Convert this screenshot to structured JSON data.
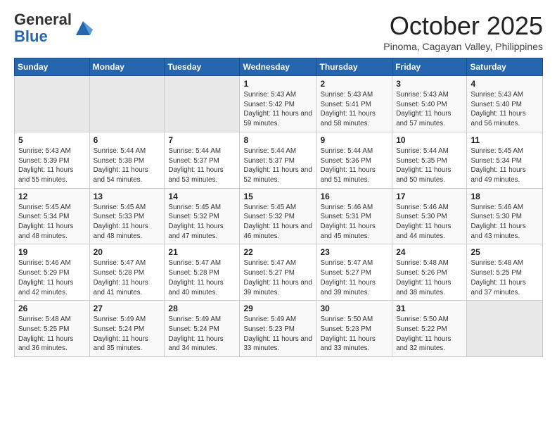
{
  "header": {
    "logo_line1": "General",
    "logo_line2": "Blue",
    "month_title": "October 2025",
    "location": "Pinoma, Cagayan Valley, Philippines"
  },
  "days_of_week": [
    "Sunday",
    "Monday",
    "Tuesday",
    "Wednesday",
    "Thursday",
    "Friday",
    "Saturday"
  ],
  "weeks": [
    [
      {
        "day": "",
        "sunrise": "",
        "sunset": "",
        "daylight": "",
        "empty": true
      },
      {
        "day": "",
        "sunrise": "",
        "sunset": "",
        "daylight": "",
        "empty": true
      },
      {
        "day": "",
        "sunrise": "",
        "sunset": "",
        "daylight": "",
        "empty": true
      },
      {
        "day": "1",
        "sunrise": "Sunrise: 5:43 AM",
        "sunset": "Sunset: 5:42 PM",
        "daylight": "Daylight: 11 hours and 59 minutes."
      },
      {
        "day": "2",
        "sunrise": "Sunrise: 5:43 AM",
        "sunset": "Sunset: 5:41 PM",
        "daylight": "Daylight: 11 hours and 58 minutes."
      },
      {
        "day": "3",
        "sunrise": "Sunrise: 5:43 AM",
        "sunset": "Sunset: 5:40 PM",
        "daylight": "Daylight: 11 hours and 57 minutes."
      },
      {
        "day": "4",
        "sunrise": "Sunrise: 5:43 AM",
        "sunset": "Sunset: 5:40 PM",
        "daylight": "Daylight: 11 hours and 56 minutes."
      }
    ],
    [
      {
        "day": "5",
        "sunrise": "Sunrise: 5:43 AM",
        "sunset": "Sunset: 5:39 PM",
        "daylight": "Daylight: 11 hours and 55 minutes."
      },
      {
        "day": "6",
        "sunrise": "Sunrise: 5:44 AM",
        "sunset": "Sunset: 5:38 PM",
        "daylight": "Daylight: 11 hours and 54 minutes."
      },
      {
        "day": "7",
        "sunrise": "Sunrise: 5:44 AM",
        "sunset": "Sunset: 5:37 PM",
        "daylight": "Daylight: 11 hours and 53 minutes."
      },
      {
        "day": "8",
        "sunrise": "Sunrise: 5:44 AM",
        "sunset": "Sunset: 5:37 PM",
        "daylight": "Daylight: 11 hours and 52 minutes."
      },
      {
        "day": "9",
        "sunrise": "Sunrise: 5:44 AM",
        "sunset": "Sunset: 5:36 PM",
        "daylight": "Daylight: 11 hours and 51 minutes."
      },
      {
        "day": "10",
        "sunrise": "Sunrise: 5:44 AM",
        "sunset": "Sunset: 5:35 PM",
        "daylight": "Daylight: 11 hours and 50 minutes."
      },
      {
        "day": "11",
        "sunrise": "Sunrise: 5:45 AM",
        "sunset": "Sunset: 5:34 PM",
        "daylight": "Daylight: 11 hours and 49 minutes."
      }
    ],
    [
      {
        "day": "12",
        "sunrise": "Sunrise: 5:45 AM",
        "sunset": "Sunset: 5:34 PM",
        "daylight": "Daylight: 11 hours and 48 minutes."
      },
      {
        "day": "13",
        "sunrise": "Sunrise: 5:45 AM",
        "sunset": "Sunset: 5:33 PM",
        "daylight": "Daylight: 11 hours and 48 minutes."
      },
      {
        "day": "14",
        "sunrise": "Sunrise: 5:45 AM",
        "sunset": "Sunset: 5:32 PM",
        "daylight": "Daylight: 11 hours and 47 minutes."
      },
      {
        "day": "15",
        "sunrise": "Sunrise: 5:45 AM",
        "sunset": "Sunset: 5:32 PM",
        "daylight": "Daylight: 11 hours and 46 minutes."
      },
      {
        "day": "16",
        "sunrise": "Sunrise: 5:46 AM",
        "sunset": "Sunset: 5:31 PM",
        "daylight": "Daylight: 11 hours and 45 minutes."
      },
      {
        "day": "17",
        "sunrise": "Sunrise: 5:46 AM",
        "sunset": "Sunset: 5:30 PM",
        "daylight": "Daylight: 11 hours and 44 minutes."
      },
      {
        "day": "18",
        "sunrise": "Sunrise: 5:46 AM",
        "sunset": "Sunset: 5:30 PM",
        "daylight": "Daylight: 11 hours and 43 minutes."
      }
    ],
    [
      {
        "day": "19",
        "sunrise": "Sunrise: 5:46 AM",
        "sunset": "Sunset: 5:29 PM",
        "daylight": "Daylight: 11 hours and 42 minutes."
      },
      {
        "day": "20",
        "sunrise": "Sunrise: 5:47 AM",
        "sunset": "Sunset: 5:28 PM",
        "daylight": "Daylight: 11 hours and 41 minutes."
      },
      {
        "day": "21",
        "sunrise": "Sunrise: 5:47 AM",
        "sunset": "Sunset: 5:28 PM",
        "daylight": "Daylight: 11 hours and 40 minutes."
      },
      {
        "day": "22",
        "sunrise": "Sunrise: 5:47 AM",
        "sunset": "Sunset: 5:27 PM",
        "daylight": "Daylight: 11 hours and 39 minutes."
      },
      {
        "day": "23",
        "sunrise": "Sunrise: 5:47 AM",
        "sunset": "Sunset: 5:27 PM",
        "daylight": "Daylight: 11 hours and 39 minutes."
      },
      {
        "day": "24",
        "sunrise": "Sunrise: 5:48 AM",
        "sunset": "Sunset: 5:26 PM",
        "daylight": "Daylight: 11 hours and 38 minutes."
      },
      {
        "day": "25",
        "sunrise": "Sunrise: 5:48 AM",
        "sunset": "Sunset: 5:25 PM",
        "daylight": "Daylight: 11 hours and 37 minutes."
      }
    ],
    [
      {
        "day": "26",
        "sunrise": "Sunrise: 5:48 AM",
        "sunset": "Sunset: 5:25 PM",
        "daylight": "Daylight: 11 hours and 36 minutes."
      },
      {
        "day": "27",
        "sunrise": "Sunrise: 5:49 AM",
        "sunset": "Sunset: 5:24 PM",
        "daylight": "Daylight: 11 hours and 35 minutes."
      },
      {
        "day": "28",
        "sunrise": "Sunrise: 5:49 AM",
        "sunset": "Sunset: 5:24 PM",
        "daylight": "Daylight: 11 hours and 34 minutes."
      },
      {
        "day": "29",
        "sunrise": "Sunrise: 5:49 AM",
        "sunset": "Sunset: 5:23 PM",
        "daylight": "Daylight: 11 hours and 33 minutes."
      },
      {
        "day": "30",
        "sunrise": "Sunrise: 5:50 AM",
        "sunset": "Sunset: 5:23 PM",
        "daylight": "Daylight: 11 hours and 33 minutes."
      },
      {
        "day": "31",
        "sunrise": "Sunrise: 5:50 AM",
        "sunset": "Sunset: 5:22 PM",
        "daylight": "Daylight: 11 hours and 32 minutes."
      },
      {
        "day": "",
        "sunrise": "",
        "sunset": "",
        "daylight": "",
        "empty": true
      }
    ]
  ]
}
